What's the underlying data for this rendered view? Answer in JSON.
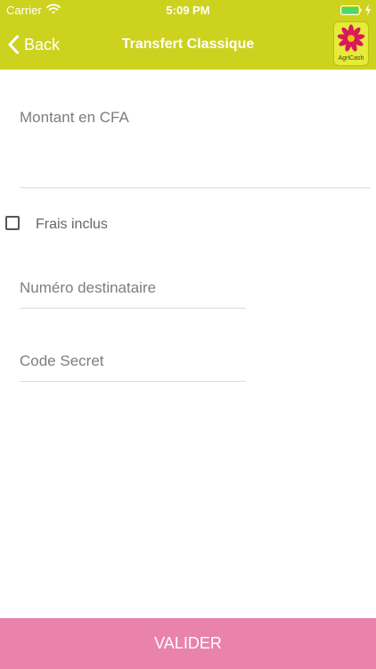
{
  "status_bar": {
    "carrier": "Carrier",
    "time": "5:09 PM",
    "wifi_icon": "wifi-icon",
    "battery_icon": "battery-icon"
  },
  "nav": {
    "back_label": "Back",
    "back_icon": "chevron-left-icon",
    "title": "Transfert Classique",
    "logo_text": "AgriCash"
  },
  "form": {
    "amount_label": "Montant en CFA",
    "fees_included_label": "Frais inclus",
    "fees_included_checked": false,
    "recipient_label": "Numéro destinataire",
    "secret_code_label": "Code Secret"
  },
  "footer": {
    "validate_label": "VALIDER"
  },
  "colors": {
    "header": "#cdd21f",
    "validate_button": "#e982ac",
    "logo_petals": "#d8195a"
  }
}
